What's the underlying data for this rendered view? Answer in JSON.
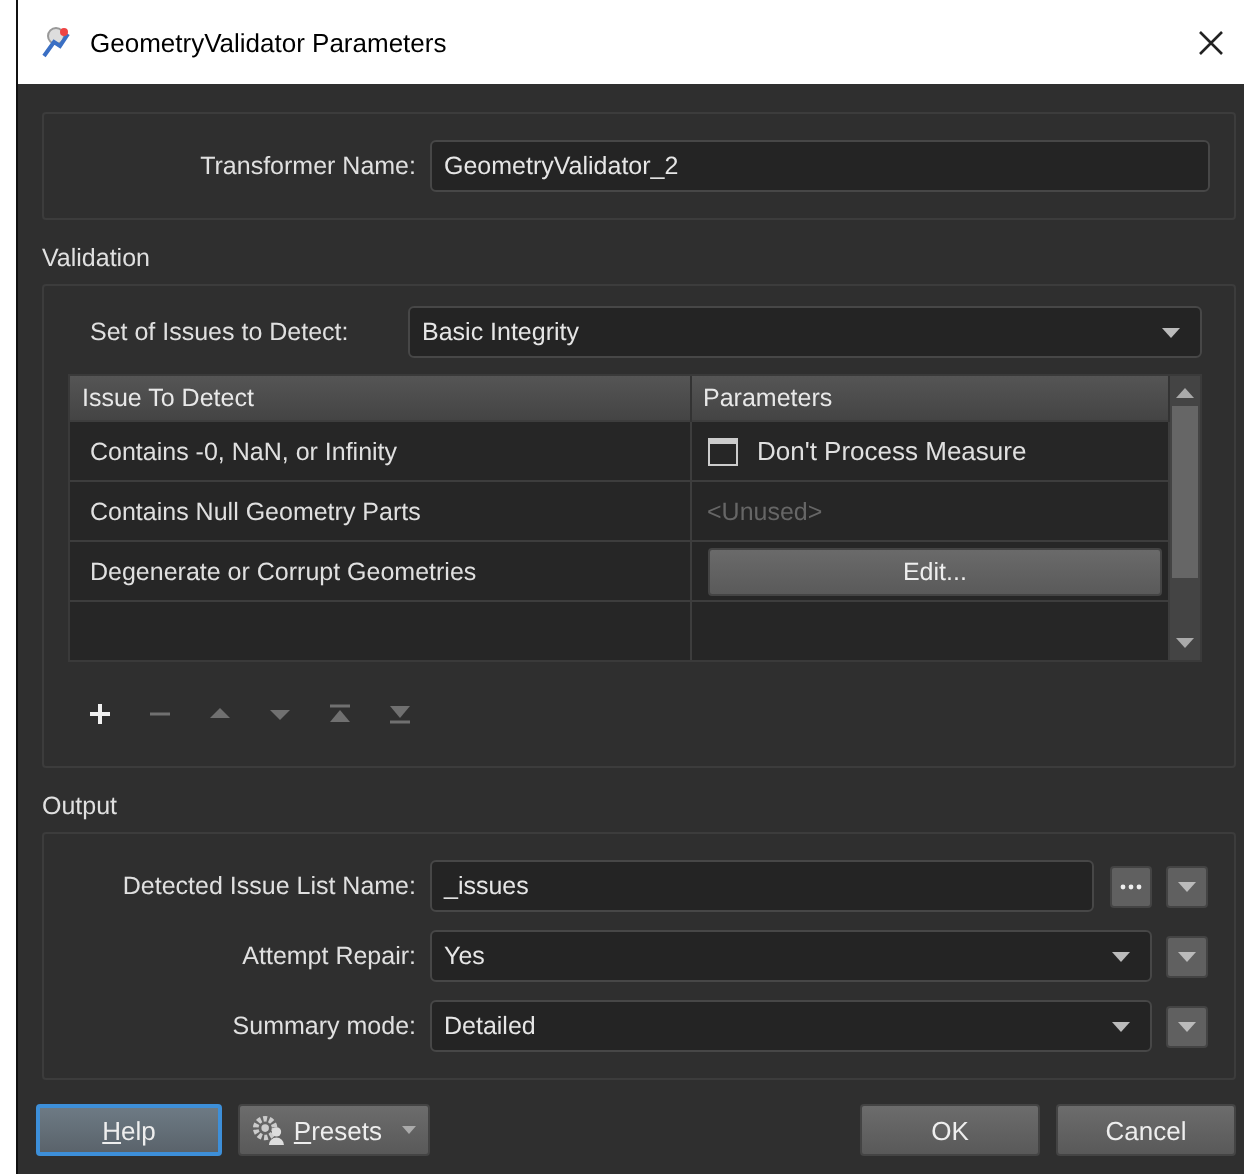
{
  "window": {
    "title": "GeometryValidator Parameters"
  },
  "transformer_name": {
    "label": "Transformer Name:",
    "value": "GeometryValidator_2"
  },
  "validation": {
    "title": "Validation",
    "set_of_issues": {
      "label": "Set of Issues to Detect:",
      "value": "Basic Integrity"
    },
    "table": {
      "columns": [
        "Issue To Detect",
        "Parameters"
      ],
      "rows": [
        {
          "issue": "Contains -0, NaN, or Infinity",
          "parameter": {
            "kind": "checkbox",
            "label": "Don't Process Measure",
            "checked": false
          }
        },
        {
          "issue": "Contains Null Geometry Parts",
          "parameter": {
            "kind": "unused",
            "text": "<Unused>"
          }
        },
        {
          "issue": "Degenerate or Corrupt Geometries",
          "parameter": {
            "kind": "button",
            "label": "Edit..."
          }
        }
      ]
    },
    "tools": [
      {
        "kind": "add",
        "disabled": false
      },
      {
        "kind": "remove",
        "disabled": true
      },
      {
        "kind": "up",
        "disabled": true
      },
      {
        "kind": "down",
        "disabled": true
      },
      {
        "kind": "top",
        "disabled": true
      },
      {
        "kind": "bottom",
        "disabled": true
      }
    ]
  },
  "output": {
    "title": "Output",
    "fields": [
      {
        "kind": "text",
        "label": "Detected Issue List Name:",
        "value": "_issues"
      },
      {
        "kind": "dropdown",
        "label": "Attempt Repair:",
        "value": "Yes"
      },
      {
        "kind": "dropdown",
        "label": "Summary mode:",
        "value": "Detailed"
      }
    ]
  },
  "buttons": [
    {
      "kind": "help",
      "label": "Help",
      "focused": true
    },
    {
      "kind": "presets",
      "label": "Presets",
      "focused": false
    },
    {
      "kind": "ok",
      "label": "OK",
      "focused": false
    },
    {
      "kind": "cancel",
      "label": "Cancel",
      "focused": false
    }
  ]
}
